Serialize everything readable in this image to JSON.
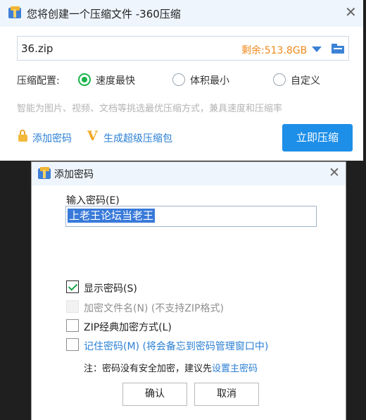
{
  "main_window": {
    "title": "您将创建一个压缩文件 -360压缩",
    "file_name": "36.zip",
    "free_space": "剩余:513.8GB",
    "config_label": "压缩配置:",
    "options": [
      {
        "label": "速度最快",
        "selected": true
      },
      {
        "label": "体积最小",
        "selected": false
      },
      {
        "label": "自定义",
        "selected": false
      }
    ],
    "hint": "智能为图片、视频、文档等挑选最优压缩方式，兼具速度和压缩率",
    "add_password": "添加密码",
    "super_pack": "生成超级压缩包",
    "compress_button": "立即压缩",
    "accent_color": "#1e8fe8",
    "free_space_color": "#f08a1c"
  },
  "password_dialog": {
    "title": "添加密码",
    "input_label": "输入密码(E)",
    "password_value": "上老王论坛当老王",
    "checkboxes": [
      {
        "label": "显示密码(S)",
        "checked": true,
        "disabled": false
      },
      {
        "label": "加密文件名(N) (不支持ZIP格式)",
        "checked": false,
        "disabled": true
      },
      {
        "label": "ZIP经典加密方式(L)",
        "checked": false,
        "disabled": false
      },
      {
        "label": "记住密码(M) (将会备忘到密码管理窗口中)",
        "checked": false,
        "disabled": false
      }
    ],
    "note_prefix": "注：密码没有安全加密，建议先",
    "note_link": "设置主密码",
    "ok_button": "确认",
    "cancel_button": "取消"
  }
}
